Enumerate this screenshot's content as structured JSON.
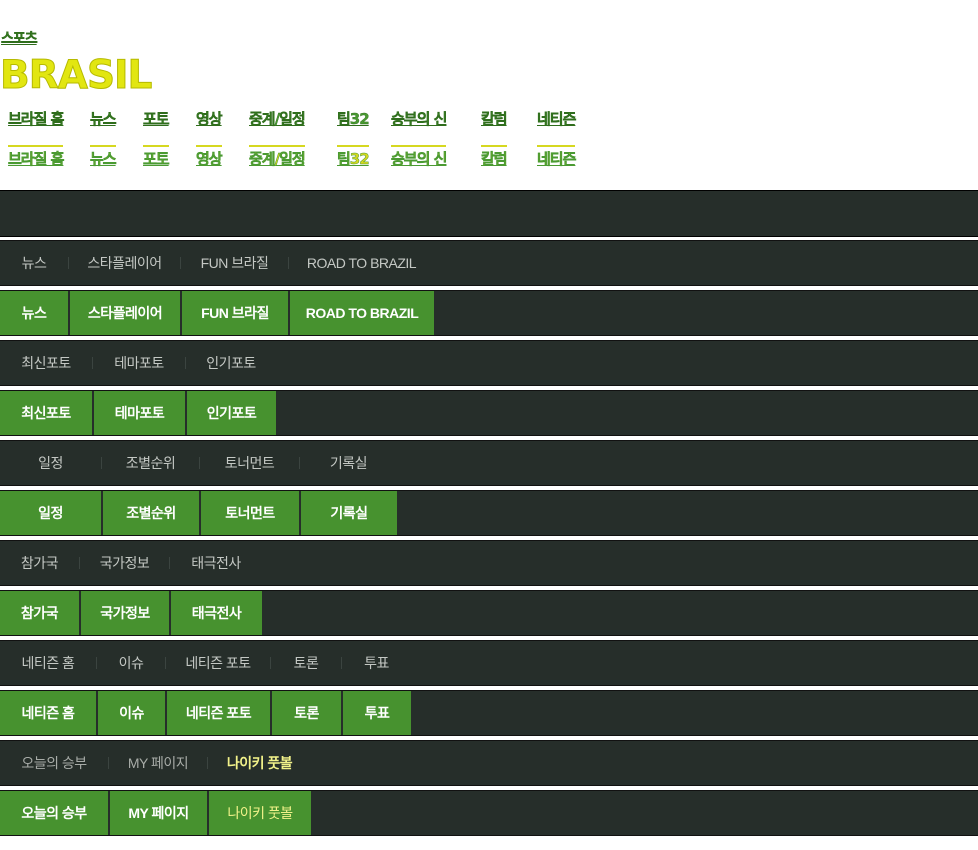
{
  "header": {
    "sports_link": "스포츠",
    "brand": "BRASIL"
  },
  "top_nav": [
    "브라질 홈",
    "뉴스",
    "포토",
    "영상",
    "중계/일정",
    "팀32",
    "승부의 신",
    "칼럼",
    "네티즌"
  ],
  "sub_navs": [
    {
      "items": [
        "뉴스",
        "스타플레이어",
        "FUN 브라질",
        "ROAD TO BRAZIL"
      ]
    },
    {
      "items": [
        "최신포토",
        "테마포토",
        "인기포토"
      ]
    },
    {
      "items": [
        "일정",
        "조별순위",
        "토너먼트",
        "기록실"
      ]
    },
    {
      "items": [
        "참가국",
        "국가정보",
        "태극전사"
      ]
    },
    {
      "items": [
        "네티즌 홈",
        "이슈",
        "네티즌 포토",
        "토론",
        "투표"
      ]
    },
    {
      "items": [
        "오늘의 승부",
        "MY 페이지",
        "나이키 풋볼"
      ]
    }
  ],
  "colors": {
    "dark_bg": "#262e2a",
    "active_green": "#47922f",
    "brand_yellow": "#e2e611",
    "link_green": "#4a9a32",
    "nike_yellow": "#f2f28a"
  }
}
